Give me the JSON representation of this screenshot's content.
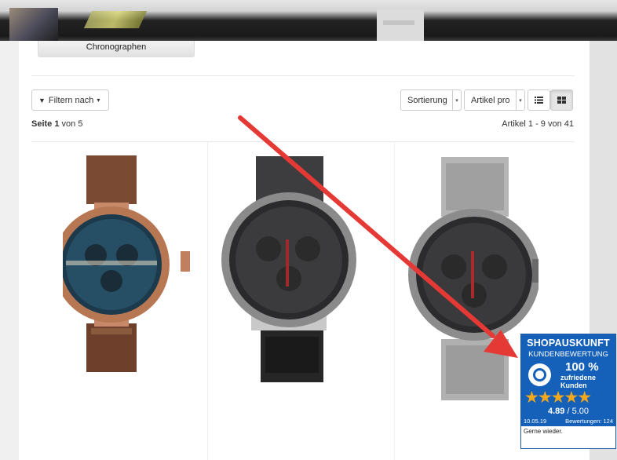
{
  "category": {
    "label": "Chronographen"
  },
  "toolbar": {
    "filter_label": "Filtern nach",
    "sort_label": "Sortierung",
    "per_page_label": "Artikel pro",
    "view_list_icon": "list-icon",
    "view_grid_icon": "grid-icon"
  },
  "pagination": {
    "page_prefix": "Seite 1",
    "page_suffix": " von 5",
    "articles": "Artikel 1 - 9 von 41"
  },
  "products": [
    {
      "image": "watch-brown-leather-blue-dial"
    },
    {
      "image": "watch-black-chronograph"
    },
    {
      "image": "watch-steel-mesh-chronograph"
    }
  ],
  "badge": {
    "title": "SHOPAUSKUNFT",
    "subtitle": "KUNDENBEWERTUNG",
    "percent": "100 %",
    "satisfied_line1": "zufriedene",
    "satisfied_line2": "Kunden",
    "stars": "★★★★★",
    "score": "4.89",
    "score_max": " / 5.00",
    "date": "10.05.19",
    "reviews": "Bewertungen: 124",
    "comment": "Gerne wieder."
  },
  "colors": {
    "badge_blue": "#1560b8",
    "star_gold": "#f4a91d",
    "arrow_red": "#e53935"
  }
}
